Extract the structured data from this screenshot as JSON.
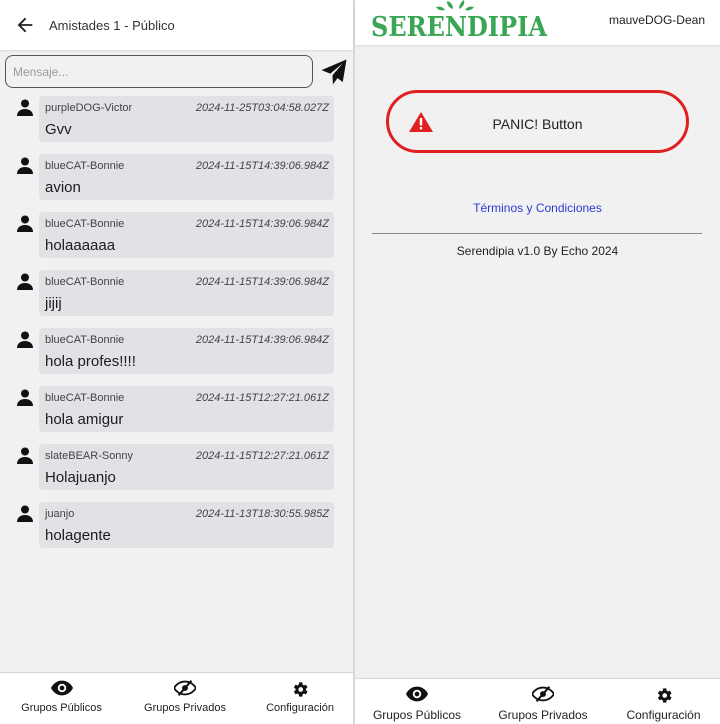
{
  "left": {
    "header": {
      "title": "Amistades 1 - Público"
    },
    "composer": {
      "placeholder": "Mensaje..."
    },
    "messages": [
      {
        "author": "purpleDOG-Victor",
        "time": "2024-11-25T03:04:58.027Z",
        "text": "Gvv"
      },
      {
        "author": "blueCAT-Bonnie",
        "time": "2024-11-15T14:39:06.984Z",
        "text": "avion"
      },
      {
        "author": "blueCAT-Bonnie",
        "time": "2024-11-15T14:39:06.984Z",
        "text": "holaaaaaa"
      },
      {
        "author": "blueCAT-Bonnie",
        "time": "2024-11-15T14:39:06.984Z",
        "text": "jijij"
      },
      {
        "author": "blueCAT-Bonnie",
        "time": "2024-11-15T14:39:06.984Z",
        "text": "hola profes!!!!"
      },
      {
        "author": "blueCAT-Bonnie",
        "time": "2024-11-15T12:27:21.061Z",
        "text": "hola amigur"
      },
      {
        "author": "slateBEAR-Sonny",
        "time": "2024-11-15T12:27:21.061Z",
        "text": "Holajuanjo"
      },
      {
        "author": "juanjo",
        "time": "2024-11-13T18:30:55.985Z",
        "text": "holagente"
      }
    ],
    "nav": [
      {
        "label": "Grupos Públicos",
        "icon": "eye-icon"
      },
      {
        "label": "Grupos Privados",
        "icon": "eye-slash-icon"
      },
      {
        "label": "Configuración",
        "icon": "gear-icon"
      }
    ]
  },
  "right": {
    "header": {
      "logo_text": "SERENDIPIA",
      "username": "mauveDOG-Dean"
    },
    "panic": {
      "label": "PANIC! Button",
      "icon": "warning-triangle-icon"
    },
    "terms_link": "Términos y Condiciones",
    "version": "Serendipia v1.0 By Echo 2024",
    "nav": [
      {
        "label": "Grupos Públicos",
        "icon": "eye-icon"
      },
      {
        "label": "Grupos Privados",
        "icon": "eye-slash-icon"
      },
      {
        "label": "Configuración",
        "icon": "gear-icon"
      }
    ]
  },
  "colors": {
    "accent_green": "#3aa655",
    "panic_red": "#e02020",
    "link_blue": "#2a3bd6",
    "bubble_bg": "#e1e1e6",
    "page_bg": "#f1f1f1"
  }
}
